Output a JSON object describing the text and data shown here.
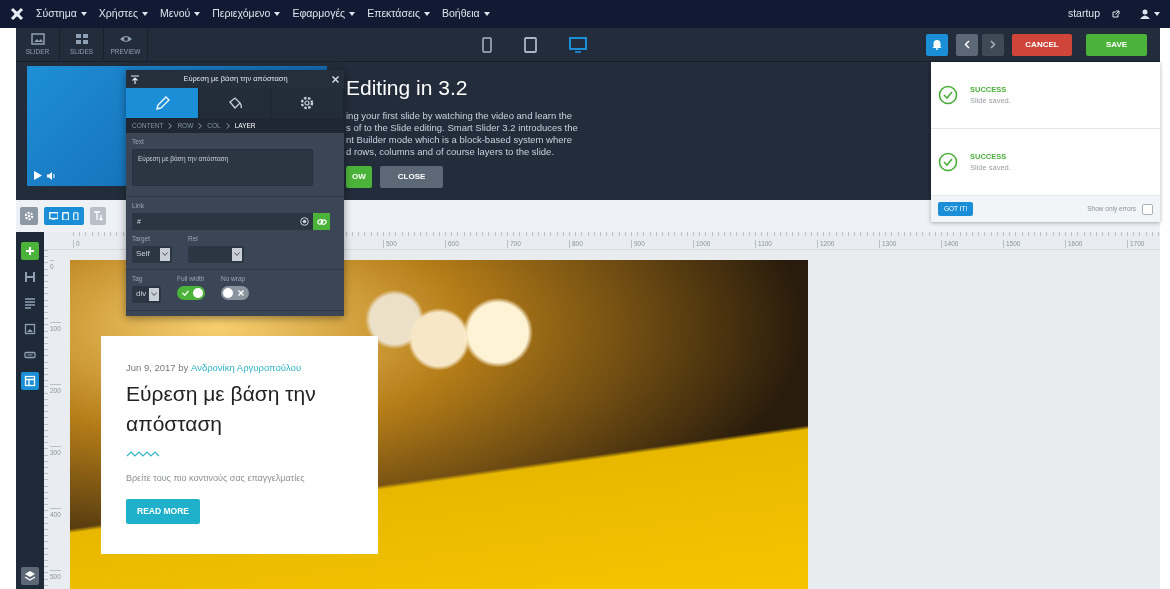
{
  "menubar": {
    "items": [
      {
        "label": "Σύστημα"
      },
      {
        "label": "Χρήστες"
      },
      {
        "label": "Μενού"
      },
      {
        "label": "Περιεχόμενο"
      },
      {
        "label": "Εφαρμογές"
      },
      {
        "label": "Επεκτάσεις"
      },
      {
        "label": "Βοήθεια"
      }
    ],
    "site": "startup"
  },
  "toolbar": {
    "buttons": [
      {
        "label": "SLIDER",
        "kind": "image"
      },
      {
        "label": "SLIDES",
        "kind": "grid"
      },
      {
        "label": "PREVIEW",
        "kind": "eye"
      }
    ],
    "devices": [
      {
        "kind": "mobile",
        "selected": false
      },
      {
        "kind": "tablet",
        "selected": false
      },
      {
        "kind": "desktop",
        "selected": true
      }
    ],
    "cancel": "CANCEL",
    "save": "SAVE"
  },
  "welcome": {
    "title": "Editing in 3.2",
    "lines": [
      "ing your first slide by watching the video and learn the",
      "s of to the Slide editing. Smart Slider 3.2 introduces the",
      "nt Builder mode which is a block-based system where",
      "d rows, columns and of course layers to the slide."
    ],
    "buttons": [
      {
        "label": "OW",
        "kind": "primary"
      },
      {
        "label": "CLOSE",
        "kind": "secondary"
      }
    ]
  },
  "notifications": {
    "items": [
      {
        "title": "SUCCESS",
        "message": "Slide saved."
      },
      {
        "title": "SUCCESS",
        "message": "Slide saved."
      }
    ],
    "got_it": "GOT IT!",
    "show_only_errors": {
      "label": "Show only errors",
      "checked": false
    }
  },
  "layer_panel": {
    "title": "Εύρεση με βάση την απόσταση",
    "tabs": [
      {
        "kind": "pencil",
        "selected": true
      },
      {
        "kind": "bucket",
        "selected": false
      },
      {
        "kind": "gear",
        "selected": false
      }
    ],
    "breadcrumb": [
      {
        "label": "CONTENT",
        "selected": false
      },
      {
        "label": "ROW",
        "selected": false
      },
      {
        "label": "COL",
        "selected": false
      },
      {
        "label": "LAYER",
        "selected": true
      }
    ],
    "text": {
      "label": "Text",
      "value": "Εύρεση με βάση την απόσταση"
    },
    "link": {
      "label": "Link",
      "value": "#"
    },
    "target": {
      "label": "Target",
      "value": "Self"
    },
    "rel": {
      "label": "Rel"
    },
    "tag": {
      "label": "Tag",
      "value": "div"
    },
    "toggles": [
      {
        "label": "Full width",
        "on": true
      },
      {
        "label": "No wrap",
        "on": false
      }
    ]
  },
  "sidebar": {
    "items": [
      {
        "kind": "add",
        "selected": false
      },
      {
        "kind": "heading",
        "selected": false
      },
      {
        "kind": "text",
        "selected": false
      },
      {
        "kind": "image",
        "selected": false
      },
      {
        "kind": "button",
        "selected": false
      },
      {
        "kind": "structure",
        "selected": true
      }
    ]
  },
  "ruler": {
    "x_labels": [
      "0",
      "500",
      "600",
      "700",
      "800",
      "900",
      "1000",
      "1100",
      "1200",
      "1300",
      "1400",
      "1500",
      "1600",
      "1700"
    ],
    "y_labels": [
      "0",
      "100",
      "200",
      "300",
      "400",
      "500"
    ]
  },
  "slide": {
    "card": {
      "date": "Jun 9, 2017 by",
      "author": "Ανδρονίκη Αργυροπούλου",
      "heading": "Εύρεση με βάση την απόσταση",
      "text": "Βρείτε τους πιο κοντινούς σας επαγγελματίες",
      "button": "READ MORE"
    }
  }
}
